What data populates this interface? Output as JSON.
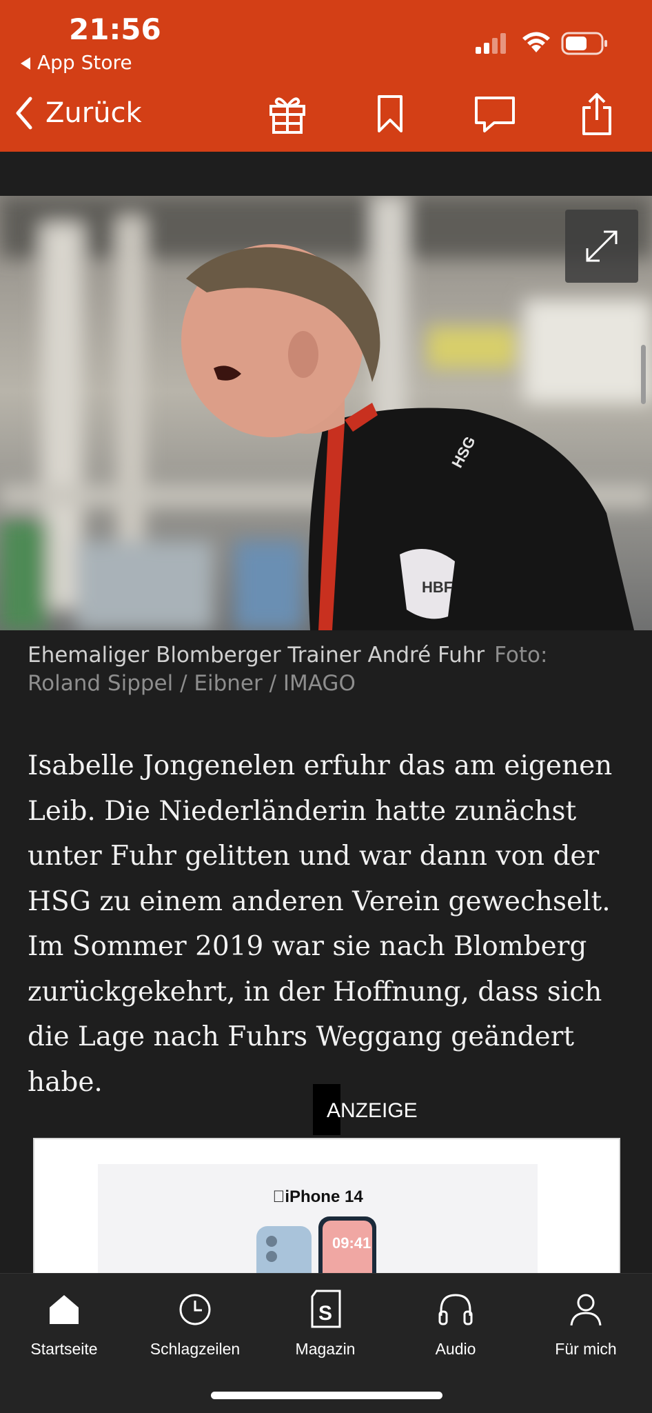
{
  "status": {
    "time": "21:56",
    "back_app": "App Store"
  },
  "nav": {
    "back_label": "Zurück"
  },
  "hero": {
    "caption": "Ehemaliger Blomberger Trainer André Fuhr",
    "credit": "Foto: Roland Sippel / Eibner / IMAGO"
  },
  "article": {
    "paragraph": "Isabelle Jongenelen erfuhr das am eigenen Leib. Die Niederländerin hatte zunächst unter Fuhr gelitten und war dann von der HSG zu einem anderen Verein gewechselt. Im Sommer 2019 war sie nach Blomberg zurückgekehrt, in der Hoffnung, dass sich die Lage nach Fuhrs Weggang geändert habe."
  },
  "ad": {
    "label": "ANZEIGE",
    "brand": "iPhone 14",
    "screen_time": "09:41"
  },
  "tabs": [
    {
      "label": "Startseite",
      "icon": "home-icon"
    },
    {
      "label": "Schlagzeilen",
      "icon": "clock-icon"
    },
    {
      "label": "Magazin",
      "icon": "magazine-icon"
    },
    {
      "label": "Audio",
      "icon": "headphones-icon"
    },
    {
      "label": "Für mich",
      "icon": "person-icon"
    }
  ],
  "colors": {
    "brand": "#d33f16",
    "background": "#1e1e1e",
    "tabbar": "#242424"
  }
}
